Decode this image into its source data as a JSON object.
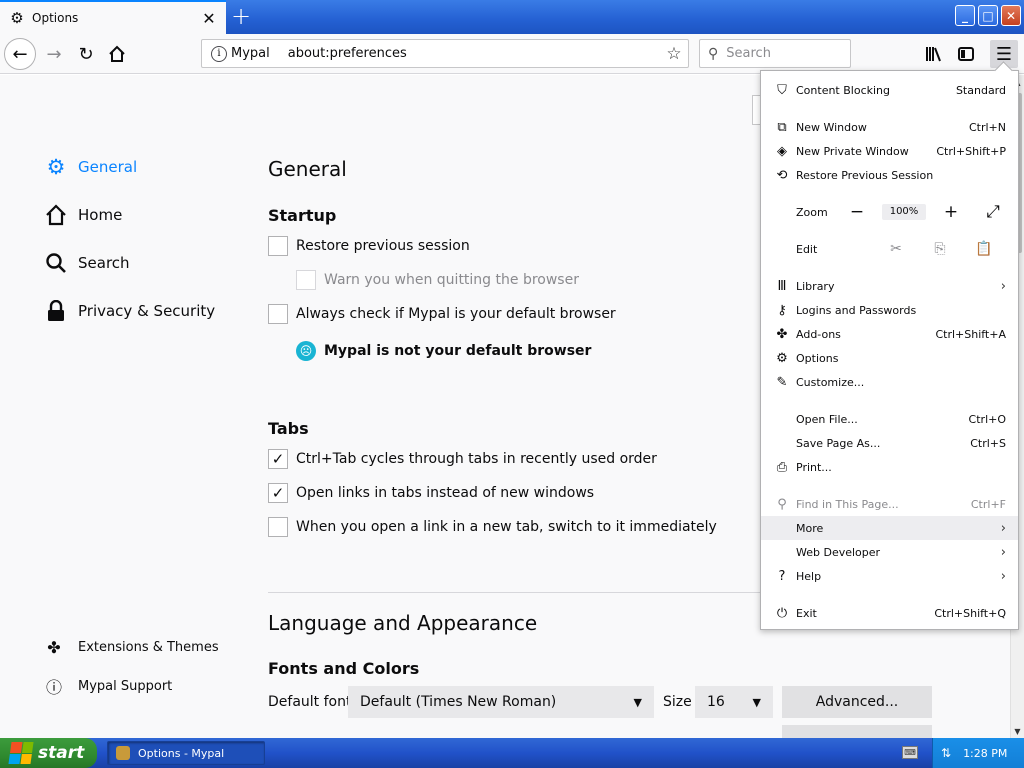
{
  "window": {
    "tab_title": "Options",
    "new_tab_symbol": "+",
    "minimize": "_",
    "maximize": "□",
    "close": "✕"
  },
  "navbar": {
    "identity_label": "Mypal",
    "url": "about:preferences",
    "search_placeholder": "Search"
  },
  "sidebar": {
    "categories": [
      {
        "label": "General",
        "icon": "gear-icon",
        "selected": true
      },
      {
        "label": "Home",
        "icon": "home-icon"
      },
      {
        "label": "Search",
        "icon": "search-icon"
      },
      {
        "label": "Privacy & Security",
        "icon": "lock-icon"
      }
    ],
    "footer": [
      {
        "label": "Extensions & Themes",
        "icon": "puzzle-icon"
      },
      {
        "label": "Mypal Support",
        "icon": "help-icon"
      }
    ]
  },
  "general": {
    "title": "General",
    "startup": {
      "heading": "Startup",
      "restore_session": {
        "label": "Restore previous session",
        "checked": false
      },
      "warn_quit": {
        "label": "Warn you when quitting the browser",
        "checked": false,
        "disabled": true
      },
      "default_check": {
        "label": "Always check if Mypal is your default browser",
        "checked": false
      },
      "not_default": "Mypal is not your default browser"
    },
    "tabs": {
      "heading": "Tabs",
      "ctrl_tab": {
        "label": "Ctrl+Tab cycles through tabs in recently used order",
        "checked": true
      },
      "open_links": {
        "label": "Open links in tabs instead of new windows",
        "checked": true
      },
      "switch_tab": {
        "label": "When you open a link in a new tab, switch to it immediately",
        "checked": false
      }
    },
    "language": {
      "heading": "Language and Appearance",
      "fonts_heading": "Fonts and Colors",
      "default_font_label": "Default font",
      "default_font_value": "Default (Times New Roman)",
      "size_label": "Size",
      "size_value": "16",
      "advanced_label": "Advanced..."
    }
  },
  "appmenu": {
    "content_blocking": {
      "label": "Content Blocking",
      "shortcut": "Standard"
    },
    "new_window": {
      "label": "New Window",
      "shortcut": "Ctrl+N"
    },
    "new_private": {
      "label": "New Private Window",
      "shortcut": "Ctrl+Shift+P"
    },
    "restore_session": {
      "label": "Restore Previous Session"
    },
    "zoom": {
      "label": "Zoom",
      "minus": "−",
      "value": "100%",
      "plus": "+"
    },
    "edit": {
      "label": "Edit"
    },
    "library": {
      "label": "Library"
    },
    "logins": {
      "label": "Logins and Passwords"
    },
    "addons": {
      "label": "Add-ons",
      "shortcut": "Ctrl+Shift+A"
    },
    "options": {
      "label": "Options"
    },
    "customize": {
      "label": "Customize..."
    },
    "open_file": {
      "label": "Open File...",
      "shortcut": "Ctrl+O"
    },
    "save_page": {
      "label": "Save Page As...",
      "shortcut": "Ctrl+S"
    },
    "print": {
      "label": "Print..."
    },
    "find": {
      "label": "Find in This Page...",
      "shortcut": "Ctrl+F"
    },
    "more": {
      "label": "More"
    },
    "web_developer": {
      "label": "Web Developer"
    },
    "help": {
      "label": "Help"
    },
    "exit": {
      "label": "Exit",
      "shortcut": "Ctrl+Shift+Q"
    }
  },
  "taskbar": {
    "start_label": "start",
    "task_label": "Options - Mypal",
    "clock": "1:28 PM"
  },
  "colors": {
    "accent": "#0a84ff",
    "taskbar": "#2152c9",
    "start": "#2f8a2f"
  }
}
